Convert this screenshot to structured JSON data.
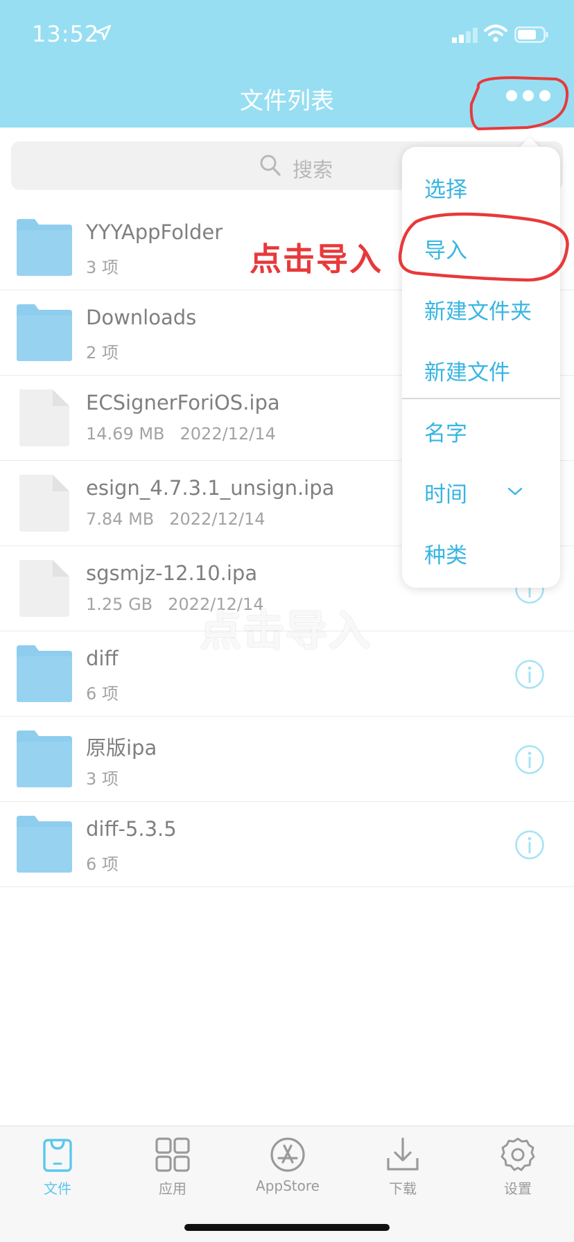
{
  "status_bar": {
    "time": "13:52"
  },
  "nav": {
    "title": "文件列表",
    "more_icon": "ellipsis-icon"
  },
  "search": {
    "placeholder": "搜索"
  },
  "files": [
    {
      "name": "YYYAppFolder",
      "kind": "folder",
      "size": "3 项",
      "date": ""
    },
    {
      "name": "Downloads",
      "kind": "folder",
      "size": "2 项",
      "date": ""
    },
    {
      "name": "ECSignerForiOS.ipa",
      "kind": "file",
      "size": "14.69 MB",
      "date": "2022/12/14"
    },
    {
      "name": "esign_4.7.3.1_unsign.ipa",
      "kind": "file",
      "size": "7.84 MB",
      "date": "2022/12/14"
    },
    {
      "name": "sgsmjz-12.10.ipa",
      "kind": "file",
      "size": "1.25 GB",
      "date": "2022/12/14"
    },
    {
      "name": "diff",
      "kind": "folder",
      "size": "6 项",
      "date": ""
    },
    {
      "name": "原版ipa",
      "kind": "folder",
      "size": "3 项",
      "date": ""
    },
    {
      "name": "diff-5.3.5",
      "kind": "folder",
      "size": "6 项",
      "date": ""
    }
  ],
  "menu": {
    "items": [
      "选择",
      "导入",
      "新建文件夹",
      "新建文件"
    ],
    "sort_items": [
      "名字",
      "时间",
      "种类"
    ]
  },
  "annotation": {
    "text": "点击导入",
    "color": "#e8393a"
  },
  "watermark": "点击导入",
  "tabbar": {
    "tabs": [
      {
        "label": "文件",
        "icon": "bag-icon",
        "active": true
      },
      {
        "label": "应用",
        "icon": "grid-icon",
        "active": false
      },
      {
        "label": "AppStore",
        "icon": "appstore-icon",
        "active": false
      },
      {
        "label": "下载",
        "icon": "download-icon",
        "active": false
      },
      {
        "label": "设置",
        "icon": "gear-icon",
        "active": false
      }
    ]
  },
  "colors": {
    "header": "#97def3",
    "accent": "#37b5e2",
    "tab_active": "#5bc7ec",
    "folder": "#8fcdee"
  }
}
